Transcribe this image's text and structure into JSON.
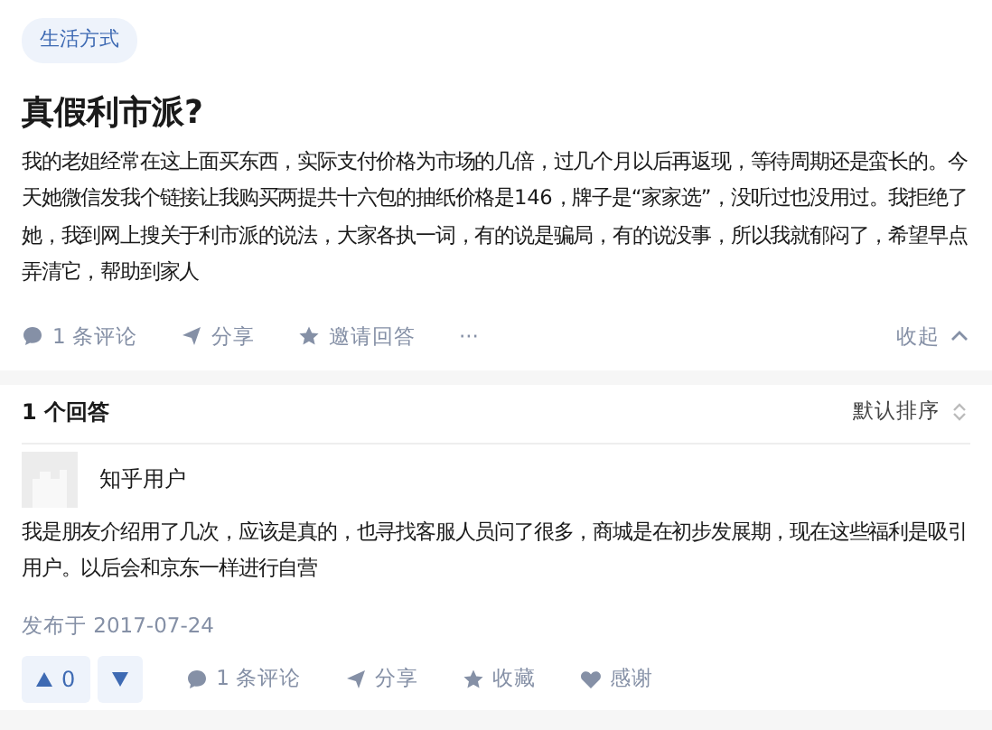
{
  "question": {
    "tag": "生活方式",
    "title": "真假利市派?",
    "body": "我的老姐经常在这上面买东西，实际支付价格为市场的几倍，过几个月以后再返现，等待周期还是蛮长的。今天她微信发我个链接让我购买两提共十六包的抽纸价格是146，牌子是“家家选”，没听过也没用过。我拒绝了她，我到网上搜关于利市派的说法，大家各执一词，有的说是骗局，有的说没事，所以我就郁闷了，希望早点弄清它，帮助到家人",
    "actions": [
      {
        "kind": "comment",
        "label": "1 条评论"
      },
      {
        "kind": "share",
        "label": "分享"
      },
      {
        "kind": "invite",
        "label": "邀请回答"
      },
      {
        "kind": "more",
        "label": "···"
      }
    ],
    "collapse": "收起"
  },
  "answers_header": {
    "count": "1 个回答",
    "sort": "默认排序"
  },
  "answer": {
    "author": "知乎用户",
    "body": "我是朋友介绍用了几次，应该是真的，也寻找客服人员问了很多，商城是在初步发展期，现在这些福利是吸引用户。以后会和京东一样进行自营",
    "date": "发布于 2017-07-24",
    "votes": "0",
    "actions": [
      {
        "kind": "comment",
        "label": "1 条评论"
      },
      {
        "kind": "share",
        "label": "分享"
      },
      {
        "kind": "favorite",
        "label": "收藏"
      },
      {
        "kind": "thanks",
        "label": "感谢"
      }
    ]
  }
}
